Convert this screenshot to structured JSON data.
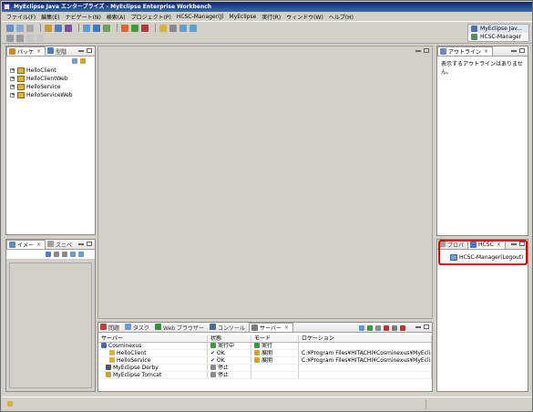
{
  "window": {
    "title": "MyEclipse Java エンタープライズ - MyEclipse Enterprise Workbench"
  },
  "menu": [
    "ファイル(F)",
    "編集(E)",
    "ナビゲート(N)",
    "検索(A)",
    "プロジェクト(P)",
    "HCSC-Manager(J)",
    "MyEclipse",
    "実行(R)",
    "ウィンドウ(W)",
    "ヘルプ(H)"
  ],
  "perspectives": [
    "MyEclipse Jav...",
    "HCSC-Manager"
  ],
  "package_view": {
    "tabs": [
      "パッケ",
      "型階"
    ],
    "projects": [
      "HelloClient",
      "HelloClientWeb",
      "HelloService",
      "HelloServiceWeb"
    ]
  },
  "image_view": {
    "tabs": [
      "イメー",
      "スニペ"
    ]
  },
  "outline_view": {
    "tab": "アウトライン",
    "message": "表示するアウトラインはありません。"
  },
  "hcsc_view": {
    "tabs": [
      "プロパ",
      "HCSC"
    ],
    "item": "HCSC-Manager(Logout)"
  },
  "bottom_view": {
    "tabs": [
      "問題",
      "タスク",
      "Web ブラウザー",
      "コンソール",
      "サーバー"
    ],
    "columns": [
      "サーバー",
      "状態",
      "モード",
      "ロケーション"
    ],
    "rows": [
      {
        "name": "Cosminexus",
        "state": "実行中",
        "mode": "実行",
        "location": ""
      },
      {
        "name": "HelloClient",
        "state": "OK",
        "mode": "展開",
        "location": "C:¥Program Files¥HITACHI¥Cosminexus¥MyEclipse¥deploy¥Hello"
      },
      {
        "name": "HelloService",
        "state": "OK",
        "mode": "展開",
        "location": "C:¥Program Files¥HITACHI¥Cosminexus¥MyEclipse¥deploy¥Hello"
      },
      {
        "name": "MyEclipse Derby",
        "state": "停止",
        "mode": "",
        "location": ""
      },
      {
        "name": "MyEclipse Tomcat",
        "state": "停止",
        "mode": "",
        "location": ""
      }
    ]
  },
  "colors": {
    "title_start": "#0a246a",
    "title_end": "#3a6ea5",
    "highlight": "#e00000"
  }
}
